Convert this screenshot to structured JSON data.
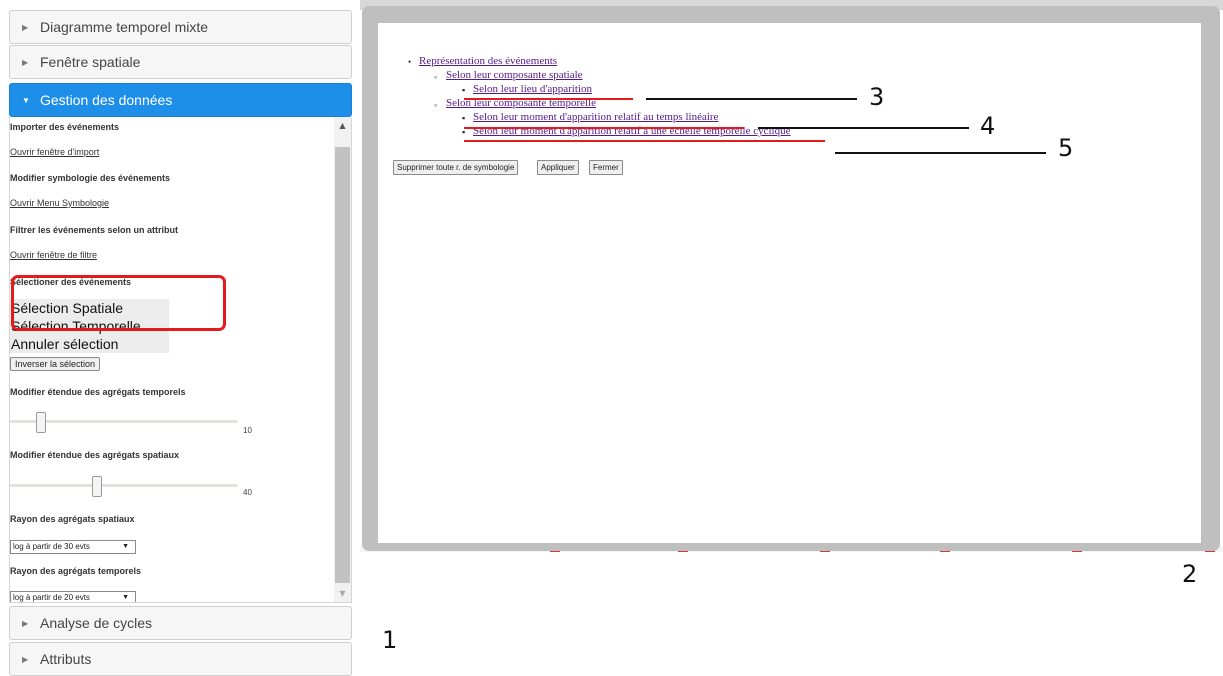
{
  "sidebar": {
    "sections": [
      {
        "label": "Diagramme temporel mixte"
      },
      {
        "label": "Fenêtre spatiale"
      },
      {
        "label": "Gestion des données"
      },
      {
        "label": "Analyse de cycles"
      },
      {
        "label": "Attributs"
      }
    ],
    "panel": {
      "import_label": "Importer des événements",
      "import_link": "Ouvrir fenêtre d'import",
      "symbology_label": "Modifier symbologie des événements",
      "symbology_link": "Ouvrir Menu Symbologie",
      "filter_label": "Filtrer les événements selon un attribut",
      "filter_link": "Ouvrir fenêtre de filtre",
      "select_label": "Sélectioner des événements",
      "select_options": [
        "Sélection Spatiale",
        "Sélection Temporelle",
        "Annuler sélection"
      ],
      "invert_button": "Inverser la sélection",
      "temporal_extent_label": "Modifier étendue des agrégats temporels",
      "temporal_extent_value": "10",
      "spatial_extent_label": "Modifier étendue des agrégats spatiaux",
      "spatial_extent_value": "40",
      "spatial_radius_label": "Rayon des agrégats spatiaux",
      "spatial_radius_value": "log à partir de 30 evts",
      "temporal_radius_label": "Rayon des agrégats temporels",
      "temporal_radius_value": "log à partir de 20 evts"
    }
  },
  "modal": {
    "tree": {
      "root": "Représentation des événements",
      "spatial": "Selon leur composante spatiale",
      "place": "Selon leur lieu d'apparition",
      "temporal": "Selon leur composante temporelle",
      "linear": "Selon leur moment d'apparition relatif au temps linéaire",
      "cyclic": "Selon leur moment d'apparition relatif à une échelle temporelle cyclique"
    },
    "buttons": {
      "delete": "Supprimer toute r. de symbologie",
      "apply": "Appliquer",
      "close": "Fermer"
    }
  },
  "annotations": [
    "1",
    "2",
    "3",
    "4",
    "5"
  ],
  "colors": {
    "accent": "#1e8fe8",
    "highlight": "#e51a1a",
    "link_visited": "#551a8b"
  }
}
